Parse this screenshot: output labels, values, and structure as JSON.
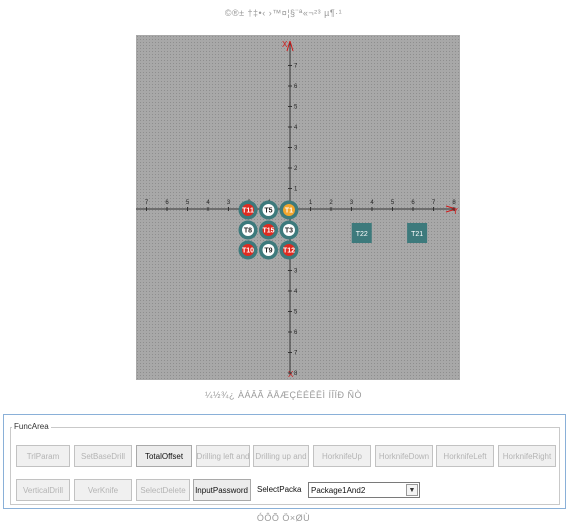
{
  "captions": {
    "top": "©®± †‡•‹ ›™¤¦§¨ª«¬²³ µ¶·¹",
    "middle": "¼½¾¿ ÀÁÂÃ ÄÅÆÇÈÉÊËÌ ÍÎÏÐ ÑÒ",
    "bottom": "ÓÔÕ Ö×ØÙ"
  },
  "plot": {
    "x_axis_label": "X",
    "y_axis_label": "Y",
    "x_ticks_left": [
      "7",
      "6",
      "5",
      "4",
      "3",
      "2",
      "1"
    ],
    "x_ticks_right": [
      "1",
      "2",
      "3",
      "4",
      "5",
      "6",
      "7",
      "8"
    ],
    "y_ticks_up": [
      "7",
      "6",
      "5",
      "4",
      "3",
      "2",
      "1"
    ],
    "y_ticks_down": [
      "1",
      "2",
      "3",
      "4",
      "5",
      "6",
      "7",
      "8"
    ],
    "tools": [
      {
        "label": "T11",
        "style": "red",
        "row": 0,
        "col": 0
      },
      {
        "label": "T5",
        "style": "white",
        "row": 0,
        "col": 1
      },
      {
        "label": "T1",
        "style": "orange",
        "row": 0,
        "col": 2
      },
      {
        "label": "T8",
        "style": "white",
        "row": 1,
        "col": 0
      },
      {
        "label": "T15",
        "style": "red",
        "row": 1,
        "col": 1
      },
      {
        "label": "T3",
        "style": "white",
        "row": 1,
        "col": 2
      },
      {
        "label": "T10",
        "style": "red",
        "row": 2,
        "col": 0
      },
      {
        "label": "T9",
        "style": "white",
        "row": 2,
        "col": 1
      },
      {
        "label": "T12",
        "style": "red",
        "row": 2,
        "col": 2
      }
    ],
    "square_tools": [
      {
        "label": "T22",
        "x": 3.5
      },
      {
        "label": "T21",
        "x": 6.2
      }
    ],
    "colors": {
      "teal": "#3d7a7c",
      "red": "#e02a1f",
      "orange": "#f2a62e",
      "axis": "#333333",
      "axis_end": "#d11a1a"
    }
  },
  "func_area": {
    "title": "FuncArea",
    "row1": [
      {
        "label": "TrlParam",
        "enabled": false
      },
      {
        "label": "SetBaseDrill",
        "enabled": false
      },
      {
        "label": "TotalOffset",
        "enabled": true
      },
      {
        "label": "Drilling left and",
        "enabled": false
      },
      {
        "label": "Drilling up and",
        "enabled": false
      },
      {
        "label": "HorknifeUp",
        "enabled": false
      },
      {
        "label": "HorknifeDown",
        "enabled": false
      },
      {
        "label": "HorknifeLeft",
        "enabled": false
      },
      {
        "label": "HorknifeRight",
        "enabled": false
      }
    ],
    "row2": [
      {
        "label": "VerticalDrill",
        "enabled": false
      },
      {
        "label": "VerKnife",
        "enabled": false
      },
      {
        "label": "SelectDelete",
        "enabled": false
      },
      {
        "label": "InputPassword",
        "enabled": true
      }
    ],
    "select_label": "SelectPacka",
    "select_value": "Package1And2"
  }
}
